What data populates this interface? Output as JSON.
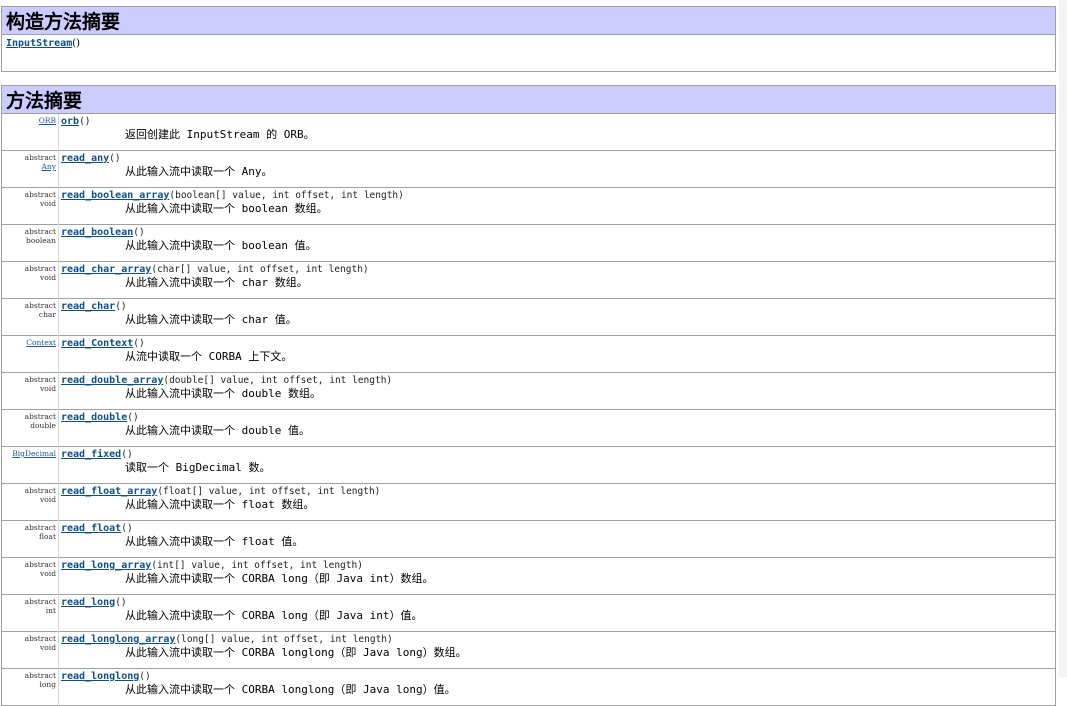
{
  "constructor_summary": {
    "heading": "构造方法摘要",
    "items": [
      {
        "name": "InputStream",
        "params": "()"
      }
    ]
  },
  "method_summary": {
    "heading": "方法摘要",
    "rows": [
      {
        "modifier": "",
        "type": "ORB",
        "type_is_link": true,
        "name": "orb",
        "params": "()",
        "desc": "返回创建此 InputStream 的 ORB。"
      },
      {
        "modifier": "abstract",
        "type": "Any",
        "type_is_link": true,
        "name": "read_any",
        "params": "()",
        "desc": "从此输入流中读取一个 Any。"
      },
      {
        "modifier": "abstract",
        "type": "void",
        "type_is_link": false,
        "name": "read_boolean_array",
        "params": "(boolean[] value, int offset, int length)",
        "desc": "从此输入流中读取一个 boolean 数组。"
      },
      {
        "modifier": "abstract",
        "type": "boolean",
        "type_is_link": false,
        "name": "read_boolean",
        "params": "()",
        "desc": "从此输入流中读取一个 boolean 值。"
      },
      {
        "modifier": "abstract",
        "type": "void",
        "type_is_link": false,
        "name": "read_char_array",
        "params": "(char[] value, int offset, int length)",
        "desc": "从此输入流中读取一个 char 数组。"
      },
      {
        "modifier": "abstract",
        "type": "char",
        "type_is_link": false,
        "name": "read_char",
        "params": "()",
        "desc": "从此输入流中读取一个 char 值。"
      },
      {
        "modifier": "",
        "type": "Context",
        "type_is_link": true,
        "name": "read_Context",
        "params": "()",
        "desc": "从流中读取一个 CORBA 上下文。"
      },
      {
        "modifier": "abstract",
        "type": "void",
        "type_is_link": false,
        "name": "read_double_array",
        "params": "(double[] value, int offset, int length)",
        "desc": "从此输入流中读取一个 double 数组。"
      },
      {
        "modifier": "abstract",
        "type": "double",
        "type_is_link": false,
        "name": "read_double",
        "params": "()",
        "desc": "从此输入流中读取一个 double 值。"
      },
      {
        "modifier": "",
        "type": "BigDecimal",
        "type_is_link": true,
        "name": "read_fixed",
        "params": "()",
        "desc": "读取一个 BigDecimal 数。"
      },
      {
        "modifier": "abstract",
        "type": "void",
        "type_is_link": false,
        "name": "read_float_array",
        "params": "(float[] value, int offset, int length)",
        "desc": "从此输入流中读取一个 float 数组。"
      },
      {
        "modifier": "abstract",
        "type": "float",
        "type_is_link": false,
        "name": "read_float",
        "params": "()",
        "desc": "从此输入流中读取一个 float 值。"
      },
      {
        "modifier": "abstract",
        "type": "void",
        "type_is_link": false,
        "name": "read_long_array",
        "params": "(int[] value, int offset, int length)",
        "desc": "从此输入流中读取一个 CORBA long（即 Java int）数组。"
      },
      {
        "modifier": "abstract",
        "type": "int",
        "type_is_link": false,
        "name": "read_long",
        "params": "()",
        "desc": "从此输入流中读取一个 CORBA long（即 Java int）值。"
      },
      {
        "modifier": "abstract",
        "type": "void",
        "type_is_link": false,
        "name": "read_longlong_array",
        "params": "(long[] value, int offset, int length)",
        "desc": "从此输入流中读取一个 CORBA longlong（即 Java long）数组。"
      },
      {
        "modifier": "abstract",
        "type": "long",
        "type_is_link": false,
        "name": "read_longlong",
        "params": "()",
        "desc": "从此输入流中读取一个 CORBA longlong（即 Java long）值。"
      }
    ]
  }
}
